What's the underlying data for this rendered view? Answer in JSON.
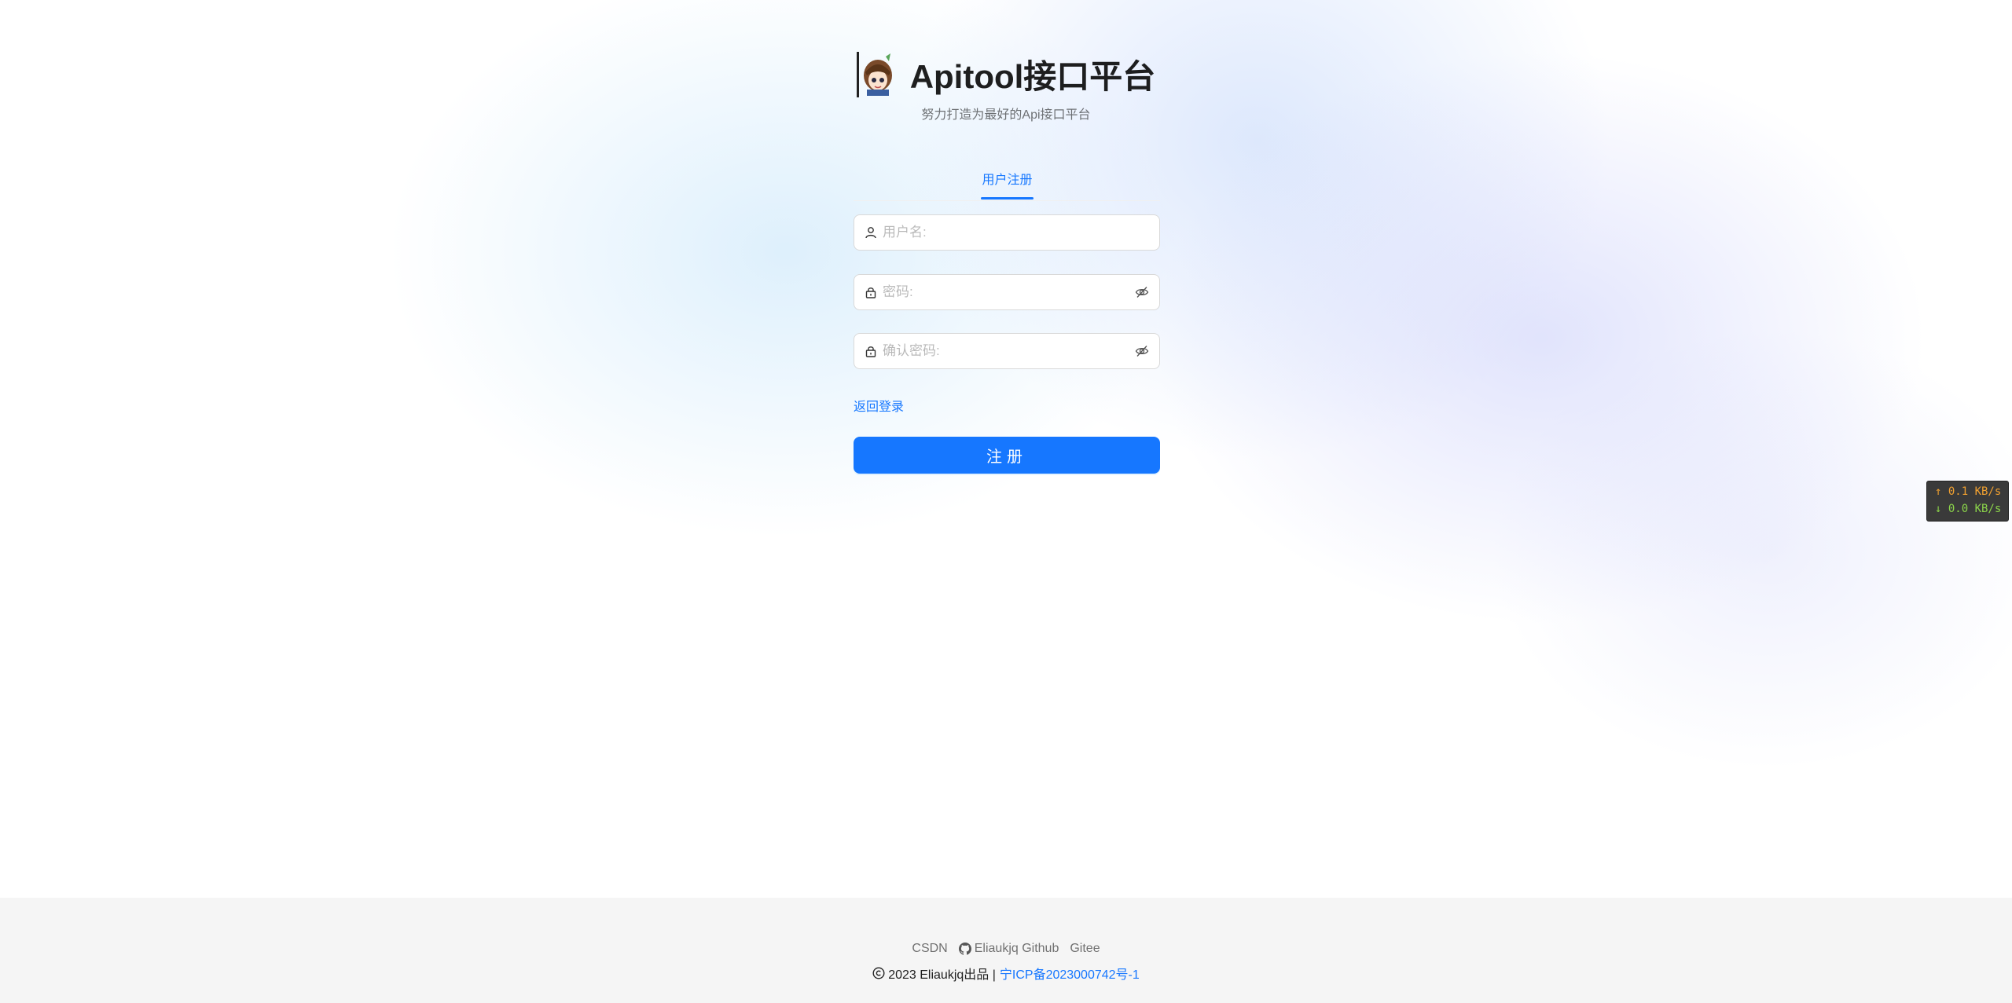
{
  "header": {
    "title": "Apitool接口平台",
    "subtitle": "努力打造为最好的Api接口平台"
  },
  "tabs": [
    {
      "label": "用户注册",
      "active": true
    }
  ],
  "form": {
    "username_placeholder": "用户名:",
    "password_placeholder": "密码:",
    "confirm_placeholder": "确认密码:",
    "back_link": "返回登录",
    "submit_label": "注册"
  },
  "netspeed": {
    "up": "↑ 0.1 KB/s",
    "down": "↓ 0.0 KB/s"
  },
  "footer": {
    "links": {
      "csdn": "CSDN",
      "github": "Eliaukjq Github",
      "gitee": "Gitee"
    },
    "copyright": "2023 Eliaukjq出品 |",
    "icp": "宁ICP备2023000742号-1"
  },
  "colors": {
    "primary": "#1677ff",
    "footer_bg": "#f5f5f5"
  },
  "icons": {
    "user": "user-icon",
    "lock": "lock-icon",
    "eye_invisible": "eye-invisible-icon",
    "github": "github-icon",
    "copyright": "copyright-icon"
  }
}
